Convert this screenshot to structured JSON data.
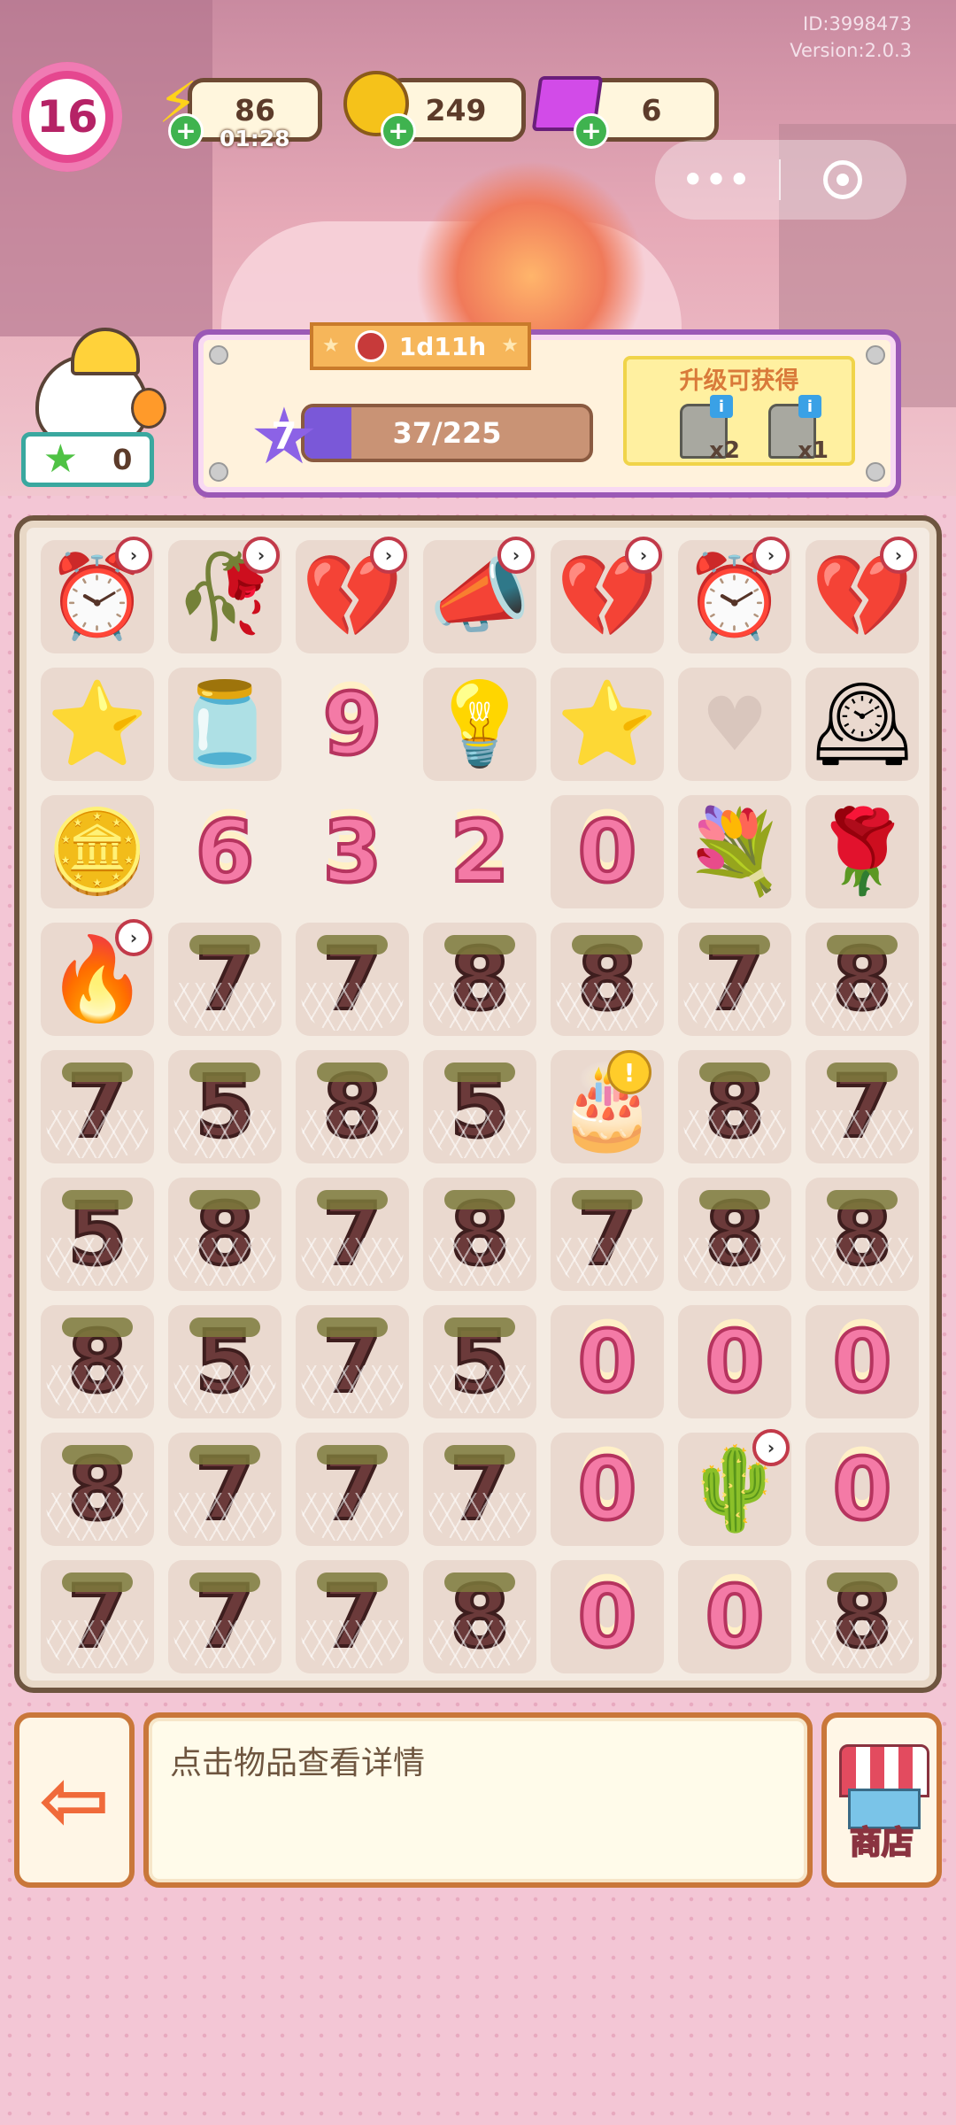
{
  "header": {
    "id_text": "ID:3998473",
    "version_text": "Version:2.0.3",
    "level": "16",
    "energy": {
      "value": "86",
      "timer": "01:28",
      "icon": "lightning-icon"
    },
    "coins": {
      "value": "249",
      "icon": "coin-icon"
    },
    "gems": {
      "value": "6",
      "icon": "gem-icon"
    },
    "capsule": {
      "more": "•••",
      "close_icon": "target-icon"
    }
  },
  "player": {
    "star_count": "0"
  },
  "event": {
    "timer": "1d11h",
    "level": "7",
    "progress_text": "37/225",
    "progress_fraction": 0.164,
    "reward_title": "升级可获得",
    "rewards": [
      {
        "icon": "stone-icon",
        "count": "x2"
      },
      {
        "icon": "stone-icon",
        "count": "x1"
      }
    ]
  },
  "board": {
    "rows": [
      [
        {
          "k": "emoji",
          "v": "⏰",
          "clock": true
        },
        {
          "k": "emoji",
          "v": "🥀",
          "clock": true
        },
        {
          "k": "emoji",
          "v": "💔",
          "clock": true
        },
        {
          "k": "emoji",
          "v": "📣",
          "clock": true
        },
        {
          "k": "emoji",
          "v": "💔",
          "clock": true
        },
        {
          "k": "emoji",
          "v": "⏰",
          "clock": true
        },
        {
          "k": "emoji",
          "v": "💔",
          "clock": true
        }
      ],
      [
        {
          "k": "emoji",
          "v": "⭐"
        },
        {
          "k": "emoji",
          "v": "🫙"
        },
        {
          "k": "pink",
          "v": "9",
          "plain": true
        },
        {
          "k": "emoji",
          "v": "💡"
        },
        {
          "k": "emoji",
          "v": "⭐"
        },
        {
          "k": "empty"
        },
        {
          "k": "emoji",
          "v": "🕰"
        }
      ],
      [
        {
          "k": "emoji",
          "v": "🪙"
        },
        {
          "k": "pink",
          "v": "6",
          "plain": true
        },
        {
          "k": "pink",
          "v": "3",
          "plain": true
        },
        {
          "k": "pink",
          "v": "2",
          "plain": true
        },
        {
          "k": "pink",
          "v": "0"
        },
        {
          "k": "emoji",
          "v": "💐"
        },
        {
          "k": "emoji",
          "v": "🌹"
        }
      ],
      [
        {
          "k": "emoji",
          "v": "🔥",
          "clock": true
        },
        {
          "k": "choc",
          "v": "7"
        },
        {
          "k": "choc",
          "v": "7"
        },
        {
          "k": "choc",
          "v": "8"
        },
        {
          "k": "choc",
          "v": "8"
        },
        {
          "k": "choc",
          "v": "7"
        },
        {
          "k": "choc",
          "v": "8"
        }
      ],
      [
        {
          "k": "choc",
          "v": "7"
        },
        {
          "k": "choc",
          "v": "5"
        },
        {
          "k": "choc",
          "v": "8"
        },
        {
          "k": "choc",
          "v": "5"
        },
        {
          "k": "emoji",
          "v": "🎂",
          "alert": true
        },
        {
          "k": "choc",
          "v": "8"
        },
        {
          "k": "choc",
          "v": "7"
        }
      ],
      [
        {
          "k": "choc",
          "v": "5"
        },
        {
          "k": "choc",
          "v": "8"
        },
        {
          "k": "choc",
          "v": "7"
        },
        {
          "k": "choc",
          "v": "8"
        },
        {
          "k": "choc",
          "v": "7"
        },
        {
          "k": "choc",
          "v": "8"
        },
        {
          "k": "choc",
          "v": "8"
        }
      ],
      [
        {
          "k": "choc",
          "v": "8"
        },
        {
          "k": "choc",
          "v": "5"
        },
        {
          "k": "choc",
          "v": "7"
        },
        {
          "k": "choc",
          "v": "5"
        },
        {
          "k": "pink",
          "v": "0"
        },
        {
          "k": "pink",
          "v": "0"
        },
        {
          "k": "pink",
          "v": "0"
        }
      ],
      [
        {
          "k": "choc",
          "v": "8"
        },
        {
          "k": "choc",
          "v": "7"
        },
        {
          "k": "choc",
          "v": "7"
        },
        {
          "k": "choc",
          "v": "7"
        },
        {
          "k": "pink",
          "v": "0"
        },
        {
          "k": "emoji",
          "v": "🌵",
          "clock": true
        },
        {
          "k": "pink",
          "v": "0"
        }
      ],
      [
        {
          "k": "choc",
          "v": "7"
        },
        {
          "k": "choc",
          "v": "7"
        },
        {
          "k": "choc",
          "v": "7"
        },
        {
          "k": "choc",
          "v": "8"
        },
        {
          "k": "pink",
          "v": "0"
        },
        {
          "k": "pink",
          "v": "0"
        },
        {
          "k": "choc",
          "v": "8"
        }
      ]
    ]
  },
  "bottom": {
    "hint": "点击物品查看详情",
    "exit_icon": "exit-arrow-icon",
    "shop_label": "商店",
    "shop_icon": "shop-icon"
  },
  "colors": {
    "accent_purple": "#9b59b6",
    "level_pink": "#e5478f",
    "frame_brown": "#6e553f"
  }
}
